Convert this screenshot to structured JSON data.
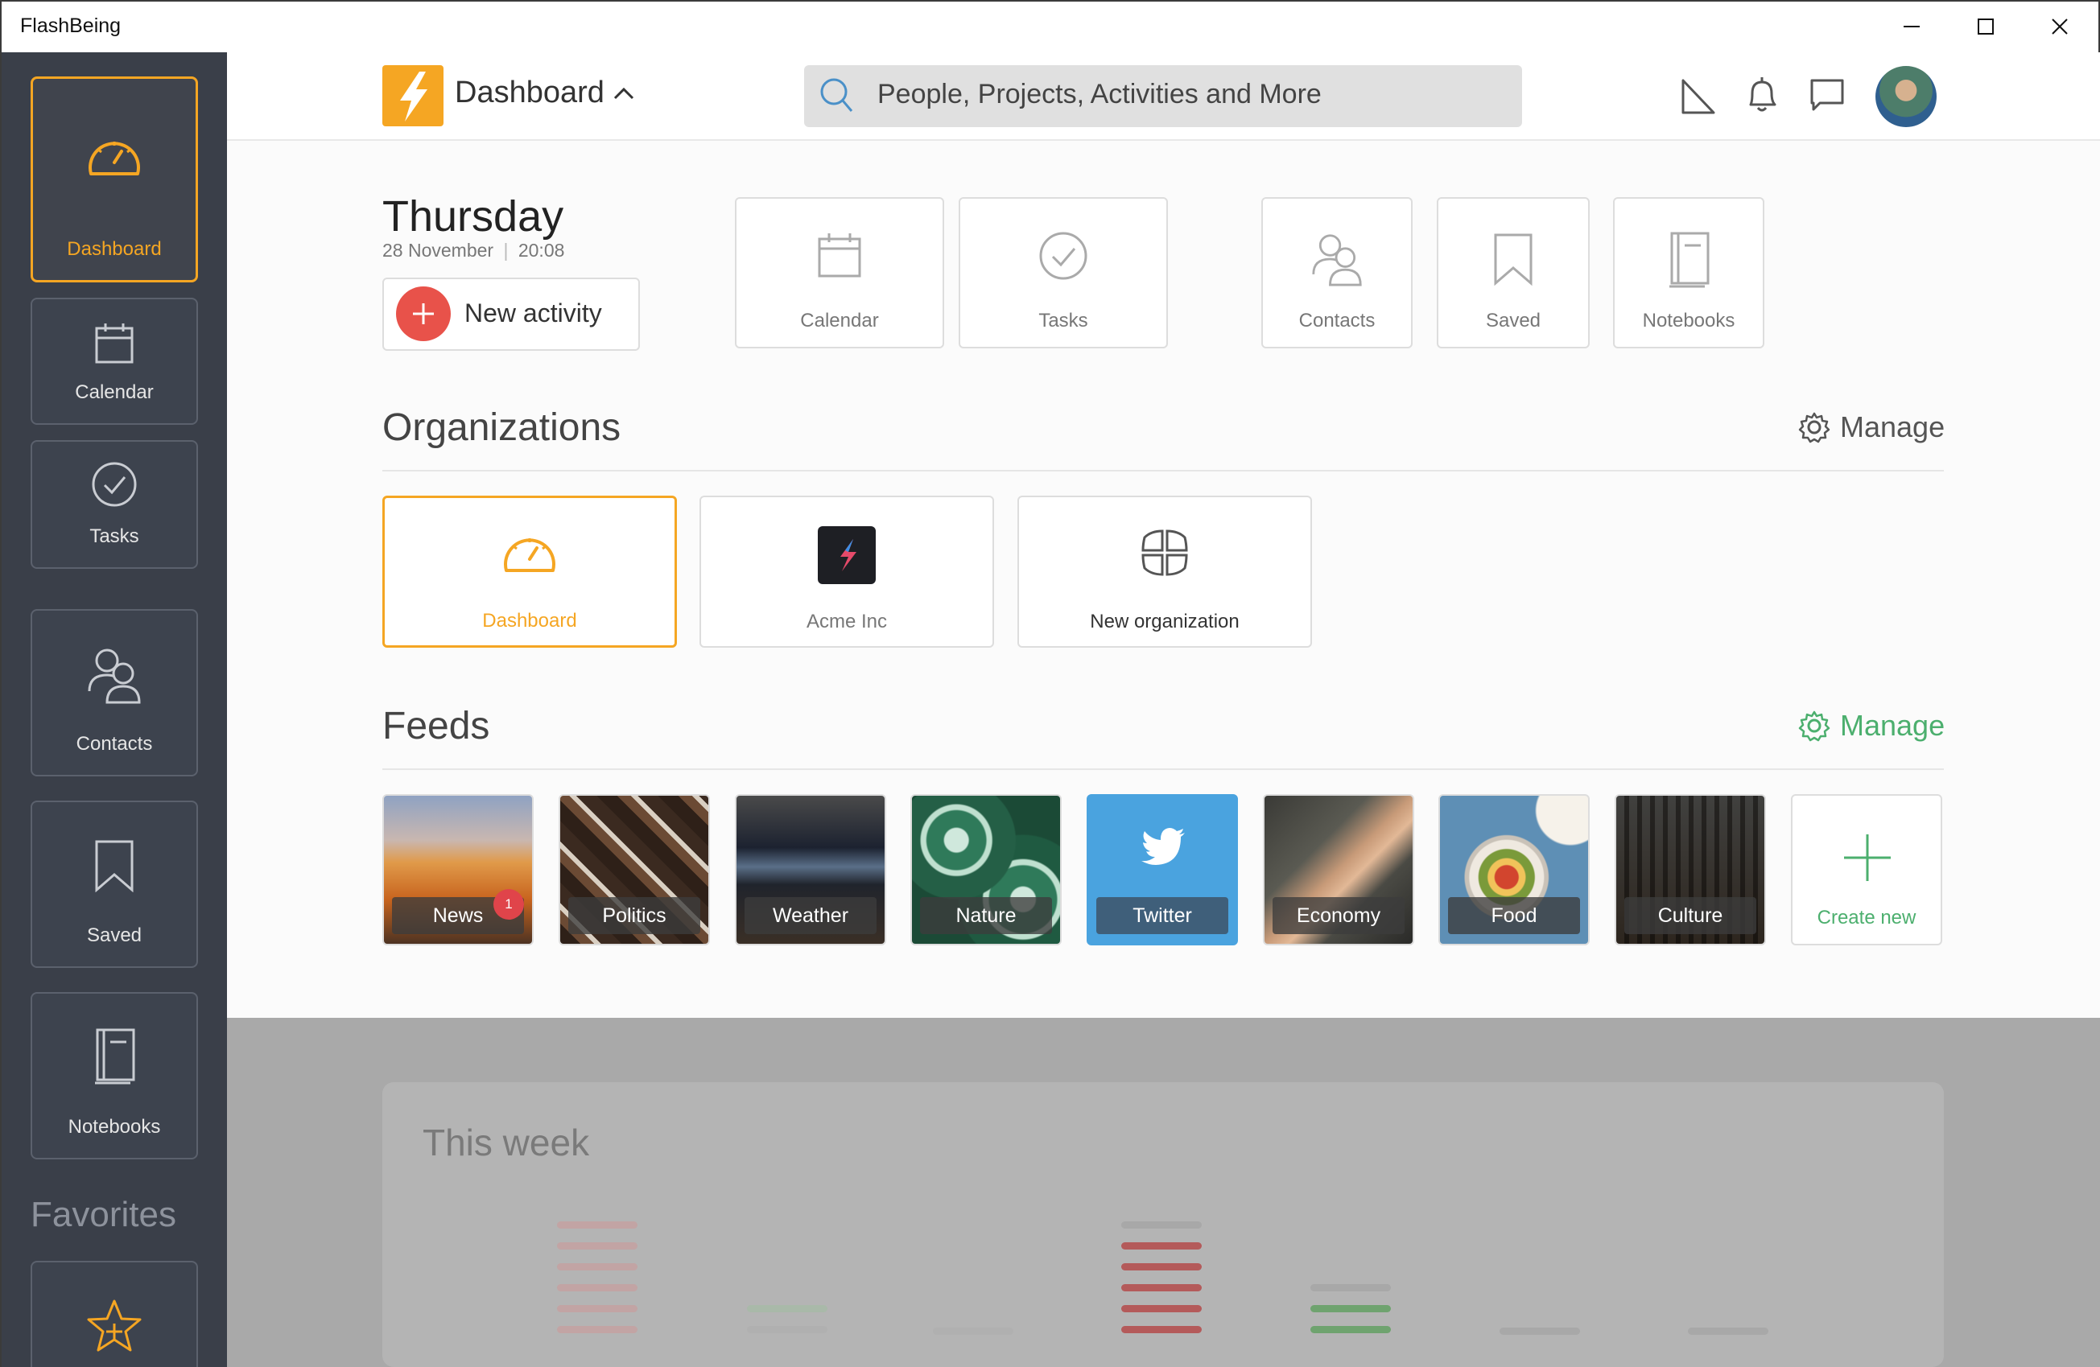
{
  "window": {
    "title": "FlashBeing"
  },
  "sidebar": {
    "items": [
      {
        "label": "Dashboard"
      },
      {
        "label": "Calendar"
      },
      {
        "label": "Tasks"
      },
      {
        "label": "Contacts"
      },
      {
        "label": "Saved"
      },
      {
        "label": "Notebooks"
      }
    ],
    "favorites_title": "Favorites"
  },
  "header": {
    "title": "Dashboard",
    "search_placeholder": "People, Projects, Activities and More"
  },
  "today": {
    "day": "Thursday",
    "date": "28 November",
    "time": "20:08",
    "new_activity": "New activity"
  },
  "quick_access": [
    {
      "label": "Calendar"
    },
    {
      "label": "Tasks"
    },
    {
      "label": "Contacts"
    },
    {
      "label": "Saved"
    },
    {
      "label": "Notebooks"
    }
  ],
  "organizations": {
    "title": "Organizations",
    "manage": "Manage",
    "items": [
      {
        "label": "Dashboard"
      },
      {
        "label": "Acme Inc"
      },
      {
        "label": "New organization"
      }
    ]
  },
  "feeds": {
    "title": "Feeds",
    "manage": "Manage",
    "items": [
      {
        "label": "News",
        "badge": "1"
      },
      {
        "label": "Politics"
      },
      {
        "label": "Weather"
      },
      {
        "label": "Nature"
      },
      {
        "label": "Twitter"
      },
      {
        "label": "Economy"
      },
      {
        "label": "Food"
      },
      {
        "label": "Culture"
      }
    ],
    "create_new": "Create new"
  },
  "this_week": {
    "title": "This week"
  },
  "colors": {
    "accent": "#f5a623",
    "sidebar_bg": "#3a3f49",
    "feeds_manage": "#4caf6e",
    "activity_red": "#e8524a",
    "twitter_blue": "#4aa3df"
  }
}
